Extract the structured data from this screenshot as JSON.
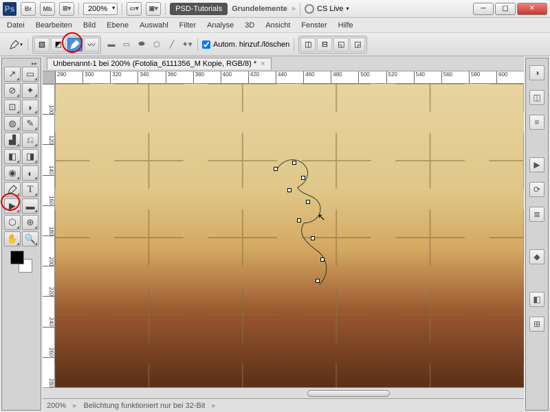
{
  "title": {
    "zoom": "200%",
    "doc_tab": "PSD-Tutorials",
    "doc_plain": "Grundelemente",
    "cslive": "CS Live"
  },
  "menus": [
    "Datei",
    "Bearbeiten",
    "Bild",
    "Ebene",
    "Auswahl",
    "Filter",
    "Analyse",
    "3D",
    "Ansicht",
    "Fenster",
    "Hilfe"
  ],
  "options": {
    "auto": "Autom. hinzuf./löschen"
  },
  "doc_tab": "Unbenannt-1 bei 200% (Fotolia_6111356_M Kopie, RGB/8) *",
  "ruler_h": [
    "280",
    "300",
    "320",
    "340",
    "360",
    "380",
    "400",
    "420",
    "440",
    "460",
    "480",
    "500",
    "520",
    "540",
    "560",
    "580",
    "600"
  ],
  "ruler_v": [
    "100",
    "120",
    "140",
    "160",
    "180",
    "200",
    "220",
    "240",
    "260",
    "280"
  ],
  "status": {
    "zoom": "200%",
    "msg": "Belichtung funktioniert nur bei 32-Bit"
  },
  "tools": [
    "↗",
    "▭",
    "⊞",
    "◫",
    "◉",
    "✂",
    "◧",
    "▤",
    "✎",
    "⌫",
    "◩",
    "◐",
    "▯",
    "◒",
    "●",
    "◔"
  ],
  "right_icons": [
    "◑",
    "◫",
    "≡",
    "",
    "▶",
    "⟳",
    "≣",
    "",
    "◆",
    "",
    "◧",
    "⊞"
  ]
}
